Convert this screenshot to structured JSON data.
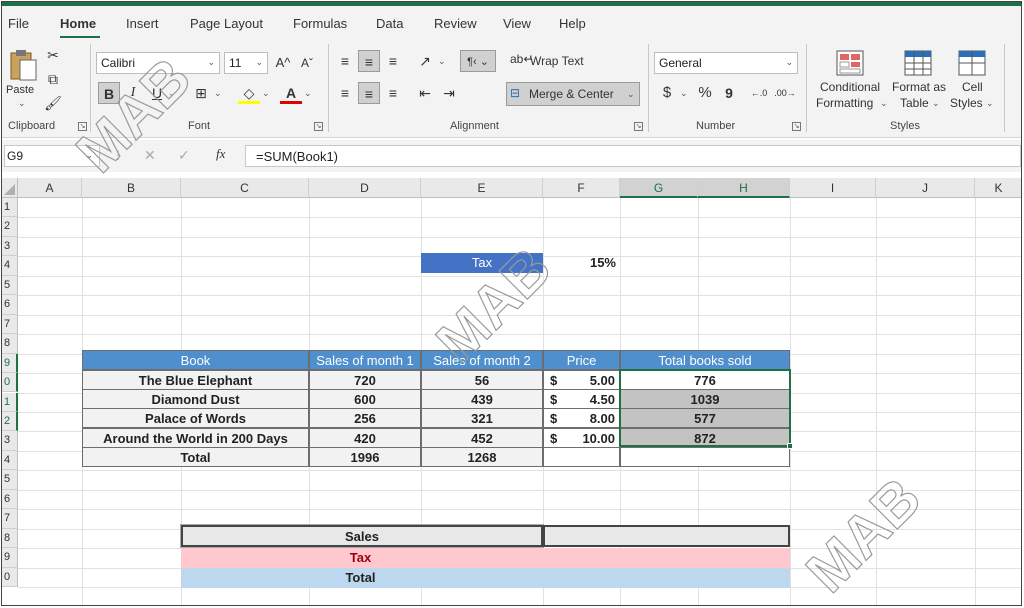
{
  "menu": {
    "items": [
      "File",
      "Home",
      "Insert",
      "Page Layout",
      "Formulas",
      "Data",
      "Review",
      "View",
      "Help"
    ]
  },
  "ribbon": {
    "clipboard": {
      "paste_label": "Paste",
      "group_label": "Clipboard"
    },
    "font": {
      "font_name": "Calibri",
      "font_size": "11",
      "bold": "B",
      "italic": "I",
      "underline": "U",
      "grow": "A^",
      "shrink": "Aˇ",
      "group_label": "Font"
    },
    "alignment": {
      "wrap_text": "Wrap Text",
      "merge_center": "Merge & Center",
      "group_label": "Alignment"
    },
    "number": {
      "format": "General",
      "currency": "$",
      "percent": "%",
      "comma": "9",
      "group_label": "Number"
    },
    "styles": {
      "conditional_1": "Conditional",
      "conditional_2": "Formatting",
      "format_table_1": "Format as",
      "format_table_2": "Table",
      "cell_styles_1": "Cell",
      "cell_styles_2": "Styles",
      "group_label": "Styles"
    }
  },
  "formula_bar": {
    "name_box": "G9",
    "fx": "fx",
    "formula": "=SUM(Book1)"
  },
  "columns": [
    "A",
    "B",
    "C",
    "D",
    "E",
    "F",
    "G",
    "H",
    "I",
    "J",
    "K"
  ],
  "rows": [
    "1",
    "2",
    "3",
    "4",
    "5",
    "6",
    "7",
    "8",
    "9",
    "0",
    "1",
    "2",
    "3",
    "4",
    "5",
    "6",
    "7",
    "8",
    "9",
    "0"
  ],
  "sheet": {
    "tax_label": "Tax",
    "tax_value": "15%",
    "headers": [
      "Book",
      "Sales of month 1",
      "Sales of month 2",
      "Price",
      "Total books sold"
    ],
    "table_rows": [
      {
        "book": "The Blue Elephant",
        "m1": "720",
        "m2": "56",
        "cur": "$",
        "price": "5.00",
        "total": "776"
      },
      {
        "book": "Diamond Dust",
        "m1": "600",
        "m2": "439",
        "cur": "$",
        "price": "4.50",
        "total": "1039"
      },
      {
        "book": "Palace of Words",
        "m1": "256",
        "m2": "321",
        "cur": "$",
        "price": "8.00",
        "total": "577"
      },
      {
        "book": "Around the World in 200 Days",
        "m1": "420",
        "m2": "452",
        "cur": "$",
        "price": "10.00",
        "total": "872"
      }
    ],
    "total_row": {
      "label": "Total",
      "m1": "1996",
      "m2": "1268"
    },
    "summary": {
      "sales": "Sales",
      "tax": "Tax",
      "total": "Total"
    }
  },
  "watermark": "MAB",
  "colors": {
    "excel_green": "#1e7145",
    "header_blue": "#4f8fcd",
    "tax_pink": "#ffc7ce",
    "tax_text": "#9c0006",
    "total_blue": "#bdd7ee"
  }
}
